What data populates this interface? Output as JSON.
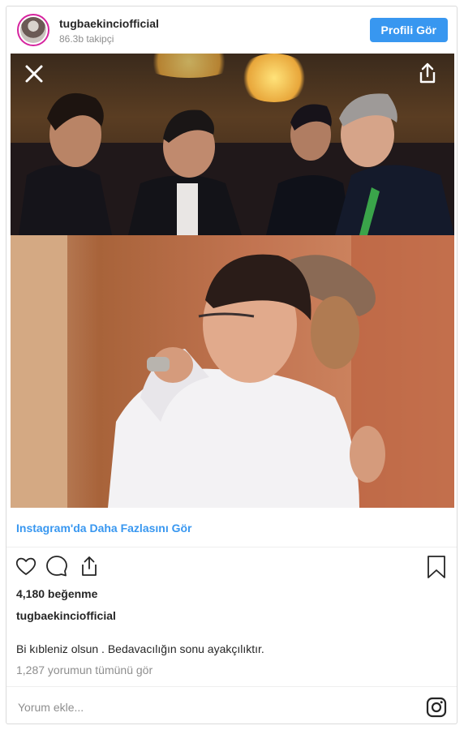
{
  "header": {
    "username": "tugbaekinciofficial",
    "followers": "86.3b takipçi",
    "profile_button": "Profili Gör"
  },
  "media": {
    "close_icon": "close-icon",
    "share_icon": "share-icon"
  },
  "footer": {
    "more_link": "Instagram'da Daha Fazlasını Gör",
    "likes": "4,180 beğenme",
    "caption_user": "tugbaekinciofficial",
    "caption": "Bi kıbleniz olsun . Bedavacılığın sonu ayakçılıktır.",
    "comments_link": "1,287 yorumun tümünü gör",
    "comment_placeholder": "Yorum ekle..."
  },
  "colors": {
    "accent": "#3897f0",
    "text": "#262626",
    "muted": "#8e8e8e",
    "border": "#dbdbdb"
  }
}
